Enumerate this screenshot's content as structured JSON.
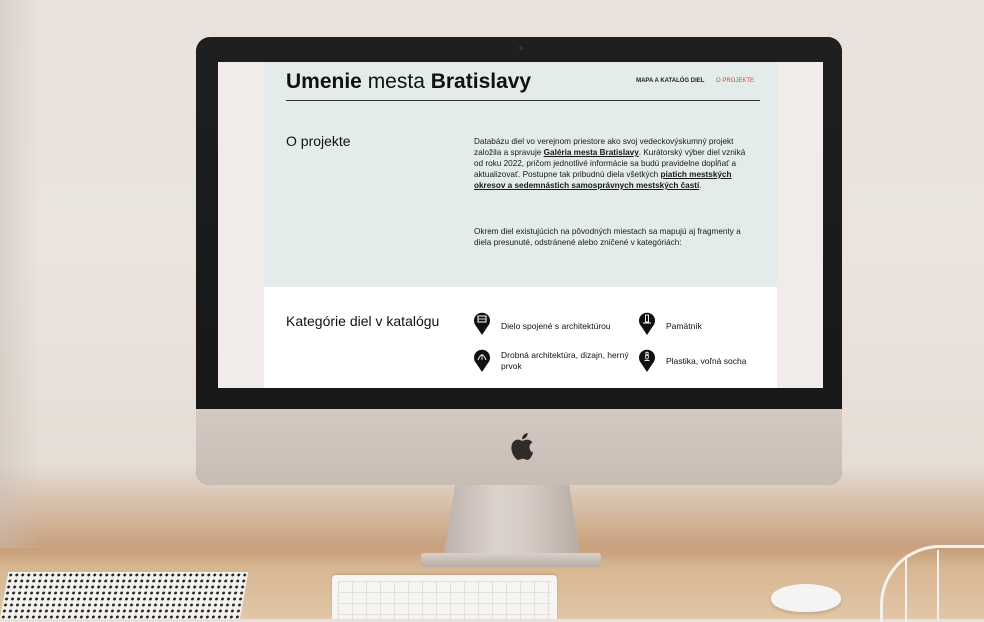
{
  "site": {
    "title_bold_1": "Umenie",
    "title_regular": " mesta ",
    "title_bold_2": "Bratislavy"
  },
  "nav": {
    "map_label": "MAPA A KATALÓG DIEL",
    "about_label": "O PROJEKTE",
    "active_color": "#e3452b"
  },
  "about": {
    "heading": "O projekte",
    "p1_a": "Databázu diel vo verejnom priestore ako svoj vedeckovýskumný projekt založila a spravuje ",
    "p1_link1": "Galéria mesta Bratislavy",
    "p1_b": ". Kurátorský výber diel vzniká od roku 2022, pričom jednotlivé informácie sa budú pravidelne dopĺňať a aktualizovať. Postupne tak pribudnú diela všetkých ",
    "p1_link2": "piatich mestských okresov a sedemnástich samosprávnych mestských častí",
    "p1_c": ".",
    "p2": "Okrem diel existujúcich na pôvodných miestach sa mapujú aj fragmenty a diela presunuté, odstránené alebo zničené v kategóriách:"
  },
  "categories": {
    "heading": "Kategórie diel v katalógu",
    "items": [
      {
        "label": "Dielo spojené s architektúrou",
        "icon": "building-pin-icon"
      },
      {
        "label": "Pamätník",
        "icon": "monument-pin-icon"
      },
      {
        "label": "Drobná architektúra, dizajn, herný prvok",
        "icon": "arch-pin-icon"
      },
      {
        "label": "Plastika, voľná socha",
        "icon": "sculpture-pin-icon"
      }
    ]
  },
  "colors": {
    "hero_bg": "#e3ebeb",
    "accent": "#e3452b"
  }
}
